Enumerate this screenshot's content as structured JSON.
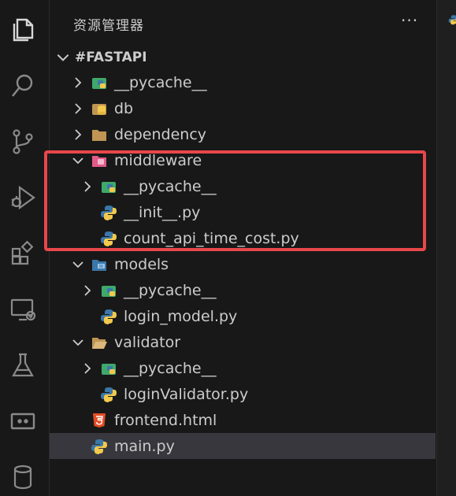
{
  "explorer": {
    "title": "资源管理器",
    "more_label": "···",
    "root_label": "#FASTAPI",
    "items": [
      {
        "label": "__pycache__"
      },
      {
        "label": "db"
      },
      {
        "label": "dependency"
      },
      {
        "label": "middleware"
      },
      {
        "label": "__pycache__"
      },
      {
        "label": "__init__.py"
      },
      {
        "label": "count_api_time_cost.py"
      },
      {
        "label": "models"
      },
      {
        "label": "__pycache__"
      },
      {
        "label": "login_model.py"
      },
      {
        "label": "validator"
      },
      {
        "label": "__pycache__"
      },
      {
        "label": "loginValidator.py"
      },
      {
        "label": "frontend.html"
      },
      {
        "label": "main.py"
      }
    ]
  },
  "colors": {
    "highlight": "#e8474b",
    "selected_row": "#37373d",
    "folder": "#c09553",
    "python_blue": "#3b77a8",
    "python_yellow": "#f2c94c",
    "html": "#e44d26"
  }
}
